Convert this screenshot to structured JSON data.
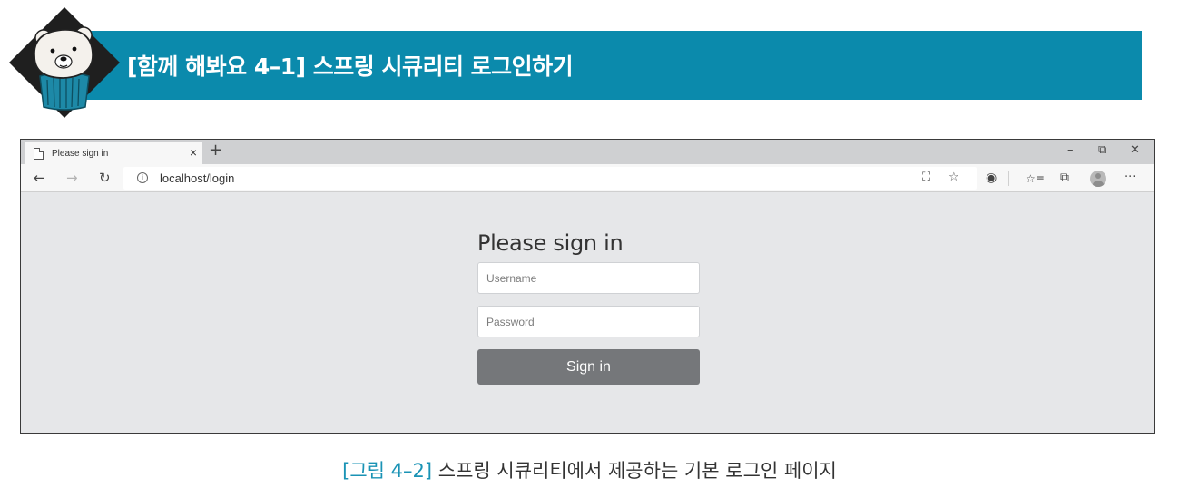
{
  "banner": {
    "title": "[함께 해봐요 4–1] 스프링 시큐리티 로그인하기",
    "bar_color": "#0b8aac"
  },
  "browser": {
    "tab_title": "Please sign in",
    "tab_close": "×",
    "new_tab": "+",
    "window_controls": {
      "minimize": "–",
      "restore": "⧉",
      "close": "✕"
    },
    "nav": {
      "back": "←",
      "forward": "→",
      "refresh": "↻"
    },
    "url": "localhost/login",
    "address_icons": {
      "translate": "⛶",
      "favorite": "☆"
    },
    "toolbar_icons": {
      "extension": "◉",
      "favorites": "☆≡",
      "collections": "⧉",
      "more": "···"
    }
  },
  "login": {
    "heading": "Please sign in",
    "username_placeholder": "Username",
    "password_placeholder": "Password",
    "submit_label": "Sign in"
  },
  "caption": {
    "figure_label": "[그림 4–2]",
    "text": "스프링 시큐리티에서 제공하는 기본 로그인 페이지"
  }
}
